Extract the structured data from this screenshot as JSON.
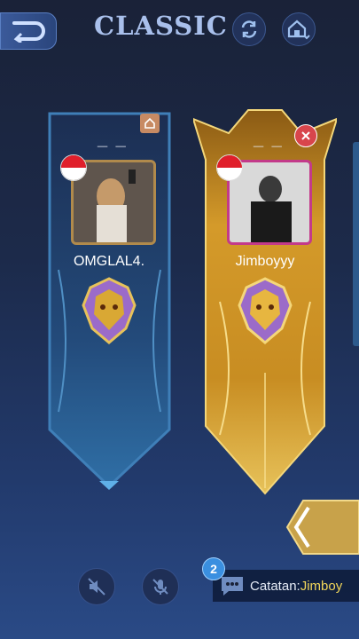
{
  "header": {
    "title": "CLASSIC",
    "back_icon": "back-arrow-icon",
    "refresh_icon": "refresh-icon",
    "home_icon": "home-dropdown-icon"
  },
  "players": [
    {
      "name": "OMGLAL4.",
      "dash": "_ _",
      "flag": "indonesia-flag",
      "rank_icon": "mythic-rank-icon",
      "corner_icon": "home-icon"
    },
    {
      "name": "Jimboyyy",
      "dash": "_ _",
      "flag": "indonesia-flag",
      "rank_icon": "mythic-rank-icon",
      "corner_icon": "close-icon"
    }
  ],
  "bottom": {
    "mute_speaker_icon": "speaker-mute-icon",
    "mute_mic_icon": "mic-mute-icon",
    "chat_badge": "2",
    "chat_label": "Catatan:",
    "chat_value": "Jimboy"
  },
  "colors": {
    "accent_blue": "#5fb0e8",
    "gold": "#d9a834",
    "chat_highlight": "#f3d75a"
  }
}
